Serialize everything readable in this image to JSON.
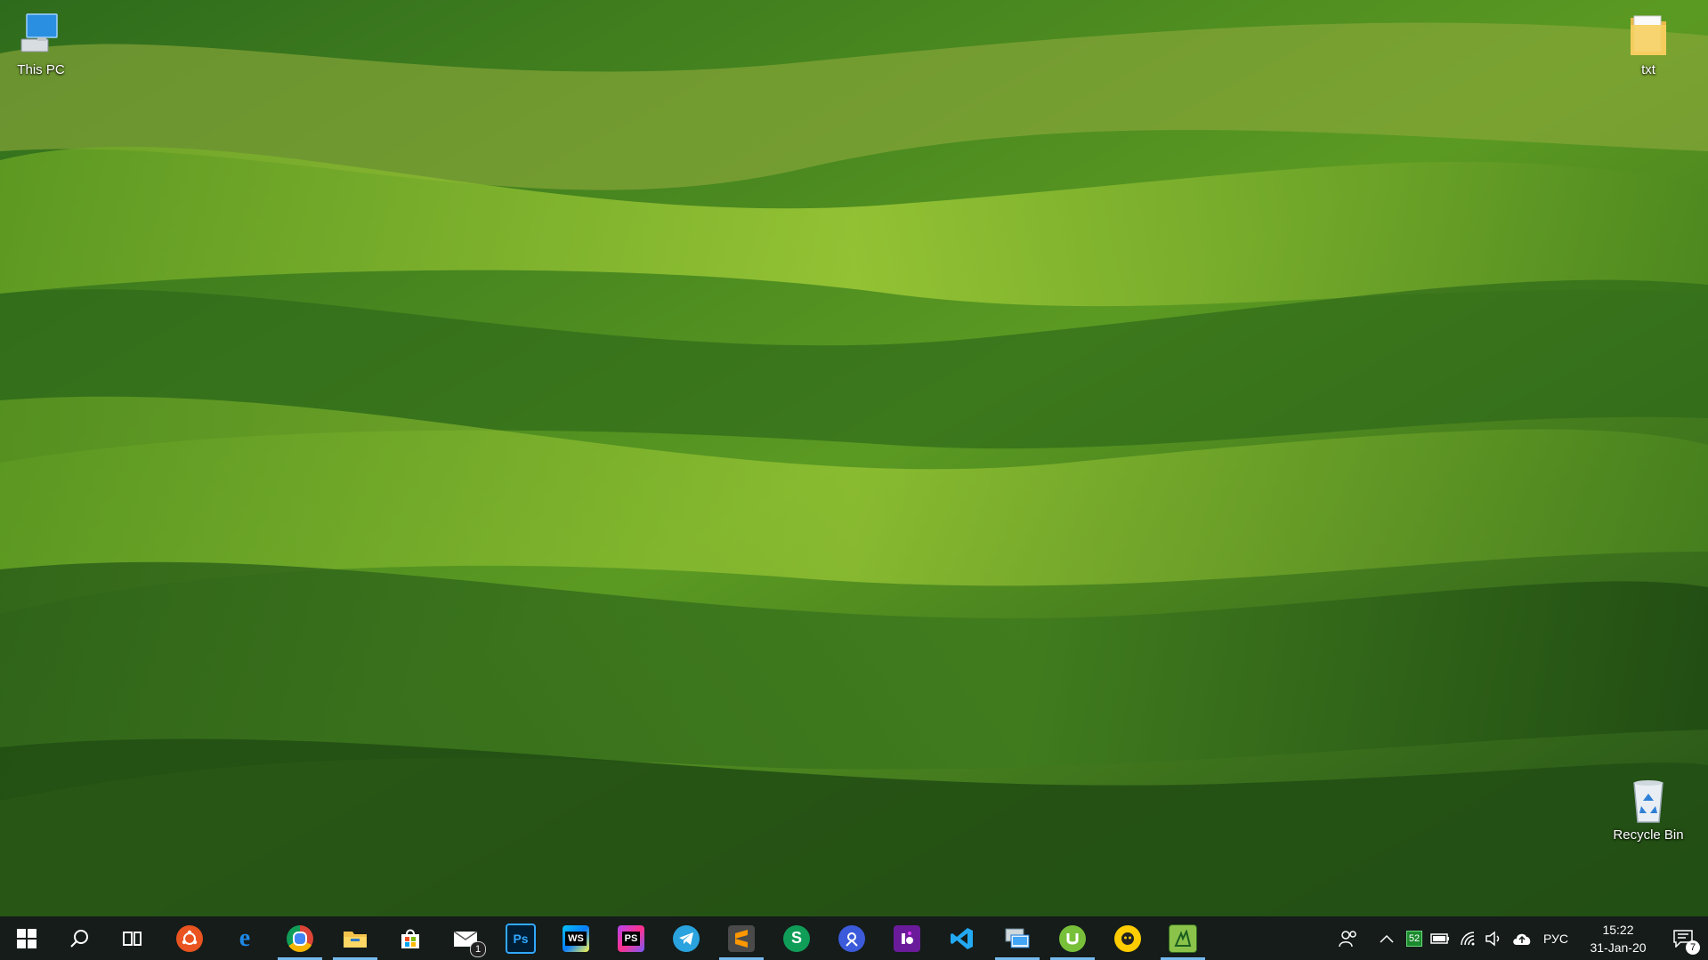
{
  "desktop": {
    "icons": {
      "this_pc": {
        "label": "This PC",
        "icon": "this-pc-icon"
      },
      "txt_folder": {
        "label": "txt",
        "icon": "folder-icon"
      },
      "recycle_bin": {
        "label": "Recycle Bin",
        "icon": "recycle-bin-icon"
      }
    }
  },
  "taskbar": {
    "colors": {
      "background": "#151c1a",
      "running_indicator": "#76b9ed"
    },
    "apps": [
      {
        "name": "Start",
        "icon": "windows-start-icon"
      },
      {
        "name": "Search",
        "icon": "search-icon"
      },
      {
        "name": "Task View",
        "icon": "task-view-icon"
      },
      {
        "name": "Ubuntu",
        "icon": "ubuntu-icon"
      },
      {
        "name": "Microsoft Edge",
        "icon": "edge-icon"
      },
      {
        "name": "Google Chrome",
        "icon": "chrome-icon"
      },
      {
        "name": "File Explorer",
        "icon": "file-explorer-icon"
      },
      {
        "name": "Microsoft Store",
        "icon": "store-icon"
      },
      {
        "name": "Mail",
        "icon": "mail-icon"
      },
      {
        "name": "Photoshop",
        "icon": "photoshop-icon",
        "text": "Ps"
      },
      {
        "name": "WebStorm",
        "icon": "webstorm-icon",
        "text": "WS"
      },
      {
        "name": "PhpStorm",
        "icon": "phpstorm-icon",
        "text": "PS"
      },
      {
        "name": "Telegram",
        "icon": "telegram-icon"
      },
      {
        "name": "Sublime Text",
        "icon": "sublime-icon"
      },
      {
        "name": "Skype for Business",
        "icon": "s-app-icon",
        "text": "S"
      },
      {
        "name": "App",
        "icon": "blue-circle-app-icon"
      },
      {
        "name": "App",
        "icon": "purple-app-icon"
      },
      {
        "name": "Visual Studio Code",
        "icon": "vscode-icon"
      },
      {
        "name": "Remote Desktop",
        "icon": "remote-desktop-icon"
      },
      {
        "name": "uTorrent",
        "icon": "utorrent-icon"
      },
      {
        "name": "CyberGhost",
        "icon": "cyberghost-icon"
      },
      {
        "name": "App",
        "icon": "green-app-icon"
      }
    ],
    "mail_badge": "1",
    "tray": {
      "people_icon": "people-icon",
      "show_hidden_icon": "chevron-up-icon",
      "battery_percent_badge": "52",
      "battery_icon": "battery-icon",
      "network_icon": "wifi-icon",
      "volume_icon": "volume-icon",
      "cloud_icon": "cloud-upload-icon",
      "language": "РУС",
      "time": "15:22",
      "date": "31-Jan-20",
      "notifications_icon": "notifications-icon",
      "notifications_badge": "7"
    }
  }
}
